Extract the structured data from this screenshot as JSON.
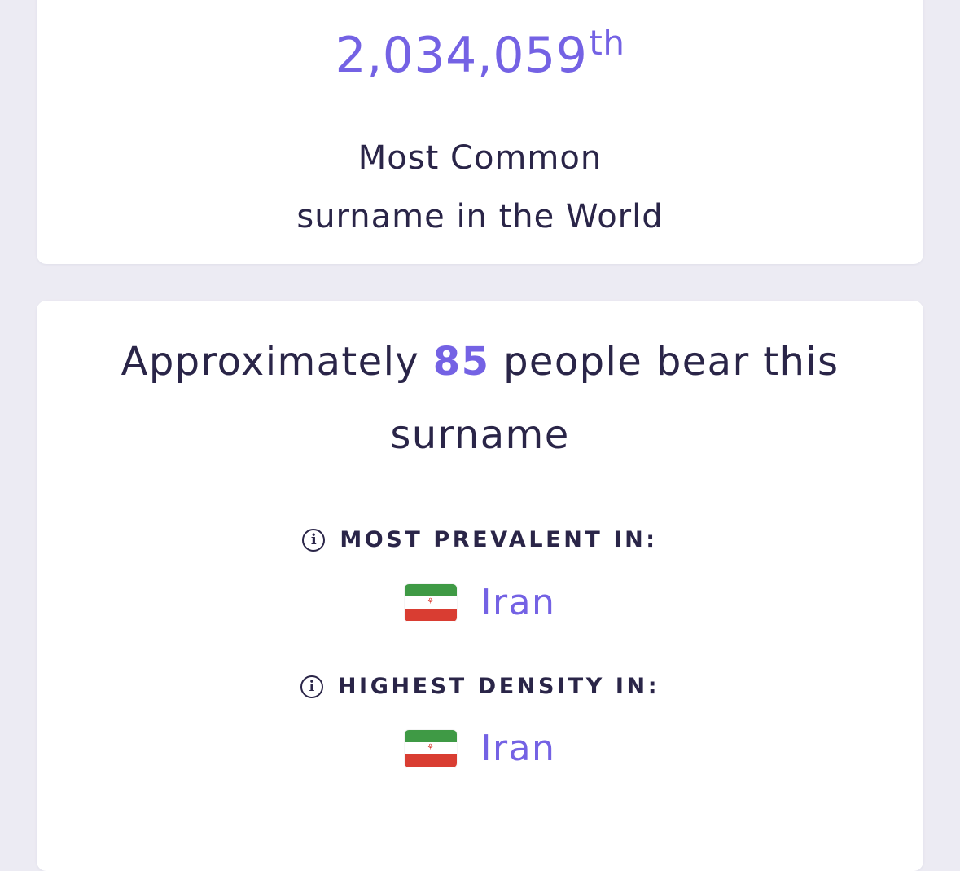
{
  "rank_card": {
    "rank_number": "2,034,059",
    "rank_suffix": "th",
    "label_line1": "Most Common",
    "label_line2": "surname in the World"
  },
  "people_card": {
    "text_before": "Approximately ",
    "count": "85",
    "text_after": " people bear this surname",
    "most_prevalent": {
      "title": "MOST PREVALENT IN:",
      "country": "Iran",
      "flag_icon": "iran-flag-icon"
    },
    "highest_density": {
      "title": "HIGHEST DENSITY IN:",
      "country": "Iran",
      "flag_icon": "iran-flag-icon"
    }
  },
  "colors": {
    "accent": "#7462e4",
    "text": "#2a2548",
    "background": "#ecebf3"
  }
}
